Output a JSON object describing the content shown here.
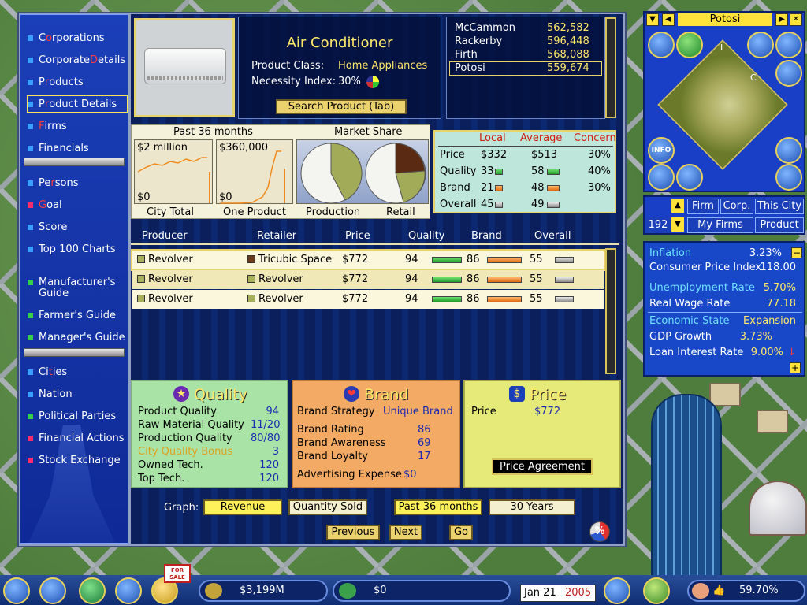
{
  "sidebar": {
    "items": [
      {
        "pre": "C",
        "hot": "o",
        "post": "rporations"
      },
      {
        "pre": "Corporate ",
        "hot": "D",
        "post": "etails"
      },
      {
        "pre": "P",
        "hot": "r",
        "post": "oducts"
      },
      {
        "pre": "P",
        "hot": "r",
        "post": "oduct Details"
      },
      {
        "pre": "",
        "hot": "F",
        "post": "irms"
      },
      {
        "pre": "Financials",
        "hot": "",
        "post": ""
      },
      {
        "pre": "Pe",
        "hot": "r",
        "post": "sons"
      },
      {
        "pre": "",
        "hot": "G",
        "post": "oal"
      },
      {
        "pre": "Score",
        "hot": "",
        "post": ""
      },
      {
        "pre": "Top 100 Charts",
        "hot": "",
        "post": ""
      },
      {
        "pre": "Manufacturer's",
        "hot": "",
        "post": ""
      },
      {
        "pre": "Guide",
        "hot": "",
        "post": ""
      },
      {
        "pre": "Farmer's Guide",
        "hot": "",
        "post": ""
      },
      {
        "pre": "Manager's Guide",
        "hot": "",
        "post": ""
      },
      {
        "pre": "Ci",
        "hot": "t",
        "post": "ies"
      },
      {
        "pre": "Nation",
        "hot": "",
        "post": ""
      },
      {
        "pre": "Political Parties",
        "hot": "",
        "post": ""
      },
      {
        "pre": "Financial Actions",
        "hot": "",
        "post": ""
      },
      {
        "pre": "Stock Exchange",
        "hot": "",
        "post": ""
      }
    ]
  },
  "product": {
    "name": "Air Conditioner",
    "class_label": "Product Class:",
    "class_value": "Home Appliances",
    "necessity_label": "Necessity Index:",
    "necessity_value": "30%",
    "search_button": "Search Product (Tab)"
  },
  "cities": [
    {
      "name": "McCammon",
      "value": "562,582"
    },
    {
      "name": "Rackerby",
      "value": "596,448"
    },
    {
      "name": "Firth",
      "value": "568,088"
    },
    {
      "name": "Potosi",
      "value": "559,674"
    }
  ],
  "charts": {
    "past_label": "Past 36 months",
    "share_label": "Market Share",
    "city_total_max": "$2 million",
    "city_total_min": "$0",
    "city_total_caption": "City Total",
    "one_product_max": "$360,000",
    "one_product_min": "$0",
    "one_product_caption": "One Product",
    "production_caption": "Production",
    "retail_caption": "Retail"
  },
  "comparison": {
    "headers": [
      "Local",
      "Average",
      "Concern"
    ],
    "rows": [
      {
        "label": "Price",
        "local": "$332",
        "avg": "$513",
        "concern": "30%"
      },
      {
        "label": "Quality",
        "local": "33",
        "avg": "58",
        "concern": "40%"
      },
      {
        "label": "Brand",
        "local": "21",
        "avg": "48",
        "concern": "30%"
      },
      {
        "label": "Overall",
        "local": "45",
        "avg": "49",
        "concern": ""
      }
    ]
  },
  "table": {
    "headers": [
      "Producer",
      "Retailer",
      "Price",
      "Quality",
      "Brand",
      "Overall"
    ],
    "rows": [
      {
        "producer": "Revolver",
        "retailer": "Tricubic Space",
        "price": "$772",
        "quality": "94",
        "brand": "86",
        "overall": "55"
      },
      {
        "producer": "Revolver",
        "retailer": "Revolver",
        "price": "$772",
        "quality": "94",
        "brand": "86",
        "overall": "55"
      },
      {
        "producer": "Revolver",
        "retailer": "Revolver",
        "price": "$772",
        "quality": "94",
        "brand": "86",
        "overall": "55"
      }
    ]
  },
  "quality": {
    "title": "Quality",
    "rows": [
      {
        "label": "Product Quality",
        "value": "94"
      },
      {
        "label": "Raw Material Quality",
        "value": "11/20"
      },
      {
        "label": "Production Quality",
        "value": "80/80"
      },
      {
        "label": "City Quality Bonus",
        "value": "3"
      },
      {
        "label": "Owned Tech.",
        "value": "120"
      },
      {
        "label": "Top Tech.",
        "value": "120"
      }
    ]
  },
  "brand": {
    "title": "Brand",
    "strategy_label": "Brand Strategy",
    "strategy_value": "Unique Brand",
    "rows": [
      {
        "label": "Brand Rating",
        "value": "86"
      },
      {
        "label": "Brand Awareness",
        "value": "69"
      },
      {
        "label": "Brand Loyalty",
        "value": "17"
      }
    ],
    "adv_label": "Advertising Expense",
    "adv_value": "$0"
  },
  "price": {
    "title": "Price",
    "label": "Price",
    "value": "$772",
    "agreement_button": "Price Agreement"
  },
  "graph_controls": {
    "label": "Graph:",
    "revenue": "Revenue",
    "quantity": "Quantity Sold",
    "past36": "Past 36 months",
    "years30": "30 Years"
  },
  "nav": {
    "previous": "Previous",
    "next": "Next",
    "go": "Go",
    "percent": "%"
  },
  "map": {
    "title": "Potosi",
    "letter_i": "I",
    "letter_c": "C",
    "info": "INFO"
  },
  "filter": {
    "firm": "Firm",
    "corp": "Corp.",
    "this_city": "This City",
    "count": "192",
    "my_firms": "My Firms",
    "product": "Product"
  },
  "economy": {
    "inflation_label": "Inflation",
    "inflation": "3.23%",
    "cpi_label": "Consumer Price Index",
    "cpi": "118.00",
    "unemp_label": "Unemployment Rate",
    "unemp": "5.70%",
    "wage_label": "Real Wage Rate",
    "wage": "77.18",
    "state_label": "Economic State",
    "state": "Expansion",
    "gdp_label": "GDP Growth",
    "gdp": "3.73%",
    "loan_label": "Loan Interest Rate",
    "loan": "9.00%"
  },
  "bottom": {
    "cash": "$3,199M",
    "profit": "$0",
    "date": "Jan 21",
    "year": "2005",
    "approval": "59.70%",
    "sale_sign": "FOR SALE"
  },
  "colors": {
    "accent_yellow": "#ffe86a",
    "sidebar_blue": "#1b3fb8",
    "quality_bg": "#a9e4a6",
    "brand_bg": "#f3aa64",
    "price_bg": "#e5ea78",
    "hotkey_red": "#ff3b3b"
  }
}
